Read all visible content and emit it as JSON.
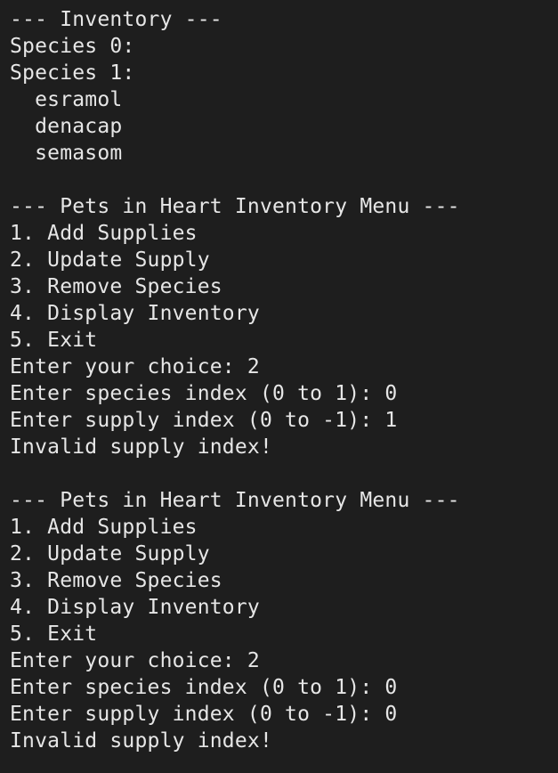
{
  "terminal": {
    "lines": [
      "--- Inventory ---",
      "Species 0:",
      "Species 1:",
      "  esramol",
      "  denacap",
      "  semasom",
      "",
      "--- Pets in Heart Inventory Menu ---",
      "1. Add Supplies",
      "2. Update Supply",
      "3. Remove Species",
      "4. Display Inventory",
      "5. Exit",
      "Enter your choice: 2",
      "Enter species index (0 to 1): 0",
      "Enter supply index (0 to -1): 1",
      "Invalid supply index!",
      "",
      "--- Pets in Heart Inventory Menu ---",
      "1. Add Supplies",
      "2. Update Supply",
      "3. Remove Species",
      "4. Display Inventory",
      "5. Exit",
      "Enter your choice: 2",
      "Enter species index (0 to 1): 0",
      "Enter supply index (0 to -1): 0",
      "Invalid supply index!"
    ]
  },
  "colors": {
    "background": "#1e1e1e",
    "text": "#e6e6e6"
  }
}
